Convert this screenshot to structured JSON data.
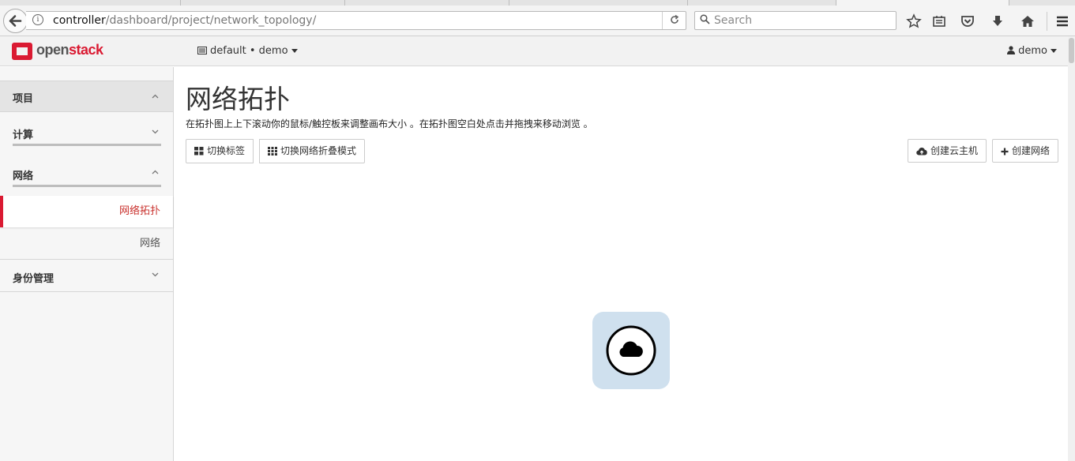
{
  "browser": {
    "url_host": "controller",
    "url_path": "/dashboard/project/network_topology/",
    "search_placeholder": "Search"
  },
  "topbar": {
    "logo_part1": "open",
    "logo_part2": "stack",
    "project_selector": "default • demo",
    "user_menu": "demo"
  },
  "sidebar": {
    "sections": [
      {
        "label": "项目"
      },
      {
        "label": "计算"
      },
      {
        "label": "网络"
      },
      {
        "label": "身份管理"
      }
    ],
    "items": [
      {
        "label": "网络拓扑"
      },
      {
        "label": "网络"
      }
    ]
  },
  "main": {
    "title": "网络拓扑",
    "description": "在拓扑图上上下滚动你的鼠标/触控板来调整画布大小 。在拓扑图空白处点击并拖拽来移动浏览 。",
    "toggle_labels_button": "切换标签",
    "toggle_collapse_button": "切换网络折叠模式",
    "create_instance_button": "创建云主机",
    "create_network_button": "创建网络"
  },
  "colors": {
    "accent": "#da1a32",
    "node_bg": "#cfe0ee"
  }
}
